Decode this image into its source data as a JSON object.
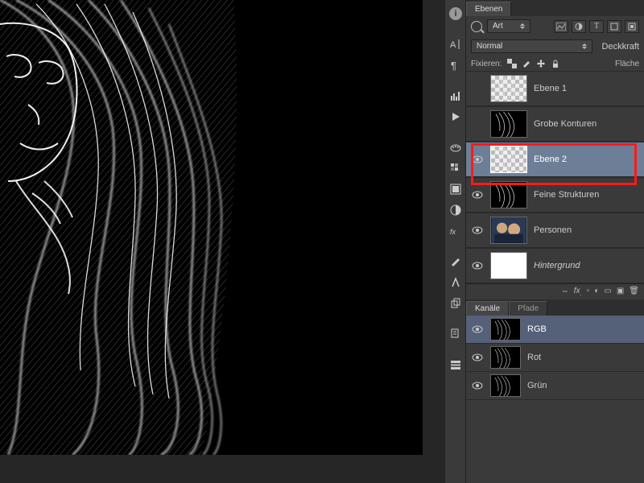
{
  "panel": {
    "tabs": {
      "layers": "Ebenen",
      "channels": "Kanäle",
      "paths": "Pfade"
    },
    "typeFilter": "Art",
    "blendMode": "Normal",
    "opacityLabel": "Deckkraft",
    "lockLabel": "Fixieren:",
    "fillLabel": "Fläche"
  },
  "layers": [
    {
      "name": "Ebene 1",
      "visible": false,
      "selected": false,
      "checker": true,
      "italic": false
    },
    {
      "name": "Grobe Konturen",
      "visible": false,
      "selected": false,
      "checker": false,
      "italic": false
    },
    {
      "name": "Ebene 2",
      "visible": true,
      "selected": true,
      "checker": true,
      "italic": false
    },
    {
      "name": "Feine Strukturen",
      "visible": true,
      "selected": false,
      "checker": false,
      "italic": false
    },
    {
      "name": "Personen",
      "visible": true,
      "selected": false,
      "checker": false,
      "italic": false,
      "photo": true
    },
    {
      "name": "Hintergrund",
      "visible": true,
      "selected": false,
      "checker": false,
      "italic": true,
      "white": true
    }
  ],
  "channels": [
    {
      "name": "RGB",
      "visible": true,
      "selected": true
    },
    {
      "name": "Rot",
      "visible": true,
      "selected": false
    },
    {
      "name": "Grün",
      "visible": true,
      "selected": false
    }
  ],
  "icons": {
    "info": "info-icon",
    "char": "A|",
    "para": "¶",
    "histogram": "histogram-icon",
    "play": "play-icon",
    "swatches": "swatches-icon",
    "styles": "styles-icon",
    "adjustments": "adjustments-icon",
    "fx": "fx",
    "brushA": "brush-a-icon",
    "brushB": "brush-b-icon",
    "brushC": "brush-c-icon",
    "notes": "notes-icon",
    "filterImg": "image-filter-icon",
    "filterAdj": "adjust-filter-icon",
    "filterText": "T",
    "filterShape": "shape-filter-icon",
    "filterSmart": "smart-filter-icon",
    "lockTrans": "lock-trans-icon",
    "lockPaint": "lock-paint-icon",
    "lockMove": "lock-move-icon",
    "lockAll": "lock-all-icon",
    "link": "∞",
    "fxLetters": "fx.",
    "mask": "◻",
    "adj": "◐",
    "folder": "▭",
    "new": "▣",
    "trash": "🗑"
  }
}
